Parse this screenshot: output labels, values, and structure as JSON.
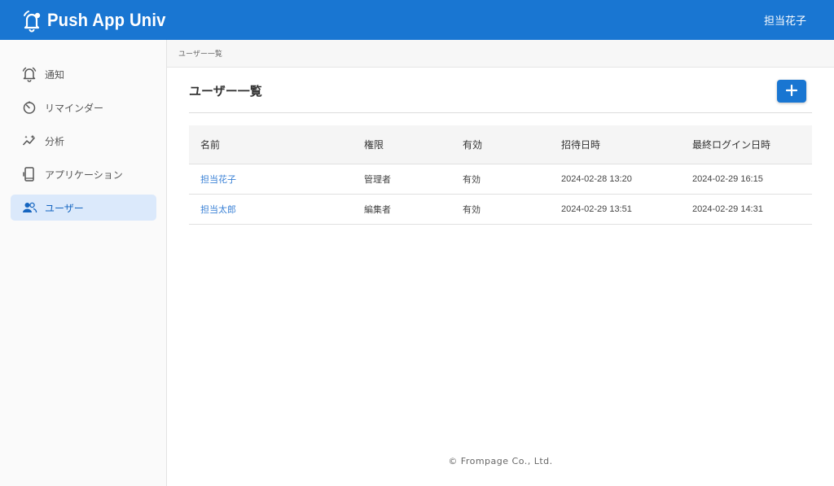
{
  "header": {
    "app_name": "Push App Univ",
    "user_name": "担当花子",
    "brand_icon": "bell-icon",
    "accent_color": "#1976d2"
  },
  "sidebar": {
    "items": [
      {
        "label": "通知",
        "icon": "bell-icon",
        "active": false
      },
      {
        "label": "リマインダー",
        "icon": "timer-icon",
        "active": false
      },
      {
        "label": "分析",
        "icon": "analytics-icon",
        "active": false
      },
      {
        "label": "アプリケーション",
        "icon": "phone-app-icon",
        "active": false
      },
      {
        "label": "ユーザー",
        "icon": "users-icon",
        "active": true
      }
    ]
  },
  "breadcrumb": "ユーザー一覧",
  "page": {
    "title": "ユーザー一覧",
    "add_button_icon": "plus-icon"
  },
  "table": {
    "columns": [
      "名前",
      "権限",
      "有効",
      "招待日時",
      "最終ログイン日時"
    ],
    "rows": [
      {
        "name": "担当花子",
        "role": "管理者",
        "active": "有効",
        "invited_at": "2024-02-28 13:20",
        "last_login": "2024-02-29 16:15"
      },
      {
        "name": "担当太郎",
        "role": "編集者",
        "active": "有効",
        "invited_at": "2024-02-29 13:51",
        "last_login": "2024-02-29 14:31"
      }
    ]
  },
  "footer": {
    "copyright": "© Frompage Co., Ltd."
  }
}
